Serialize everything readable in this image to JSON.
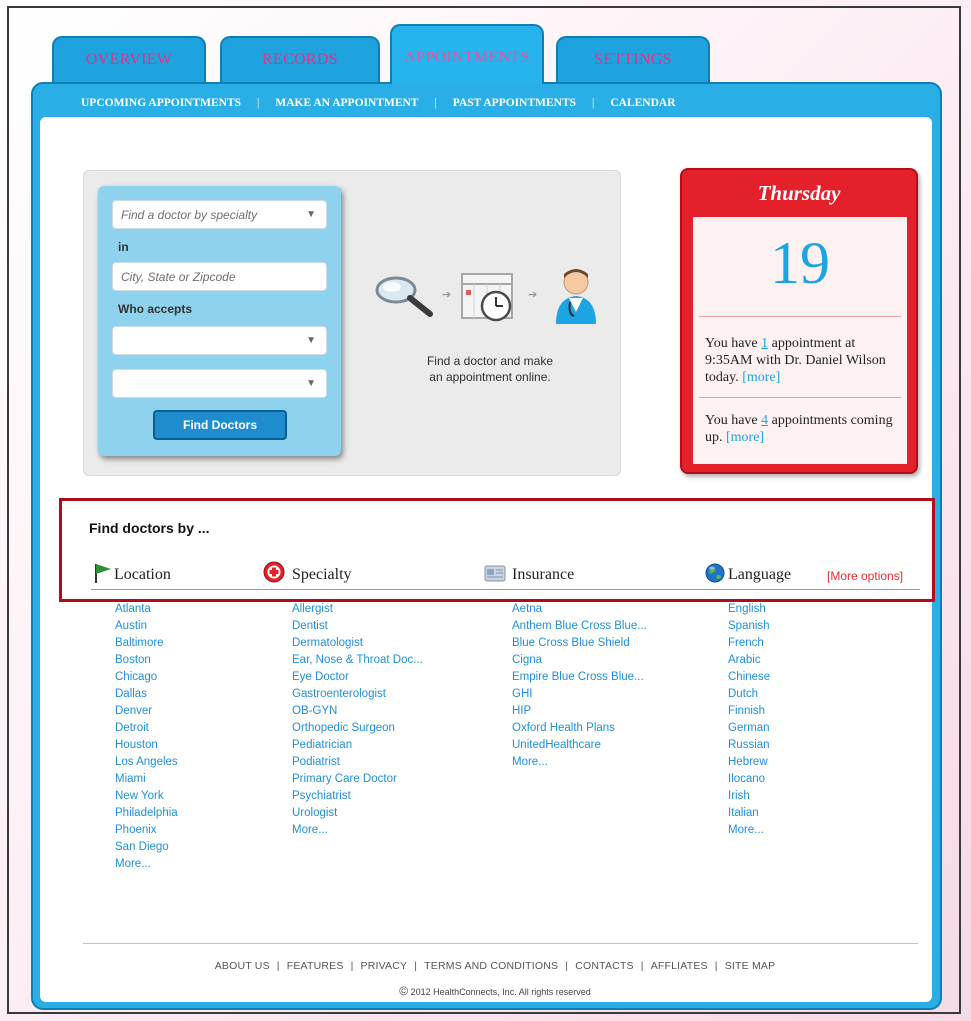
{
  "tabs": [
    "OVERVIEW",
    "RECORDS",
    "APPOINTMENTS",
    "SETTINGS"
  ],
  "subnav": [
    "UPCOMING APPOINTMENTS",
    "MAKE AN APPOINTMENT",
    "PAST APPOINTMENTS",
    "CALENDAR"
  ],
  "subnav_sep": "|",
  "search": {
    "specialty_placeholder": "Find a doctor by specialty",
    "in_label": "in",
    "location_placeholder": "City, State or Zipcode",
    "accepts_label": "Who accepts",
    "select1": "",
    "select2": "",
    "find_button": "Find Doctors",
    "caption_line1": "Find a doctor and make",
    "caption_line2": "an appointment online."
  },
  "calendar": {
    "day": "Thursday",
    "date": "19",
    "msg1_pre": "You have ",
    "msg1_num": "1",
    "msg1_post": " appointment at 9:35AM with Dr. Daniel Wilson today. ",
    "msg2_pre": "You have ",
    "msg2_num": "4",
    "msg2_post": " appointments coming up. ",
    "more": "[more]"
  },
  "find_by": {
    "title": "Find doctors by ...",
    "categories": [
      "Location",
      "Specialty",
      "Insurance",
      "Language"
    ],
    "more_options": "[More options]",
    "location": [
      "Atlanta",
      "Austin",
      "Baltimore",
      "Boston",
      "Chicago",
      "Dallas",
      "Denver",
      "Detroit",
      "Houston",
      "Los Angeles",
      "Miami",
      "New York",
      "Philadelphia",
      "Phoenix",
      "San Diego",
      "More..."
    ],
    "specialty": [
      "Allergist",
      "Dentist",
      "Dermatologist",
      "Ear, Nose & Throat Doc...",
      "Eye Doctor",
      "Gastroenterologist",
      "OB-GYN",
      "Orthopedic Surgeon",
      "Pediatrician",
      "Podiatrist",
      "Primary Care Doctor",
      "Psychiatrist",
      "Urologist",
      "More..."
    ],
    "insurance": [
      "Aetna",
      "Anthem Blue Cross Blue...",
      "Blue Cross Blue Shield",
      "Cigna",
      "Empire Blue Cross Blue...",
      "GHI",
      "HIP",
      "Oxford Health Plans",
      "UnitedHealthcare",
      "More..."
    ],
    "language": [
      "English",
      "Spanish",
      "French",
      "Arabic",
      "Chinese",
      "Dutch",
      "Finnish",
      "German",
      "Russian",
      "Hebrew",
      "Ilocano",
      "Irish",
      "Italian",
      "More..."
    ]
  },
  "footer": {
    "links": [
      "ABOUT US",
      "FEATURES",
      "PRIVACY",
      "TERMS AND CONDITIONS",
      "CONTACTS",
      "AFFLIATES",
      "SITE MAP"
    ],
    "sep": "|",
    "copyright_symbol": "©",
    "copyright": "2012 HealthConnects, Inc.  All rights reserved"
  },
  "colors": {
    "tab_blue": "#1ea3de",
    "tab_text": "#e6308a",
    "link_blue": "#1f8fd7",
    "calendar_red": "#e4202a",
    "highlight_red": "#b00d1a"
  }
}
